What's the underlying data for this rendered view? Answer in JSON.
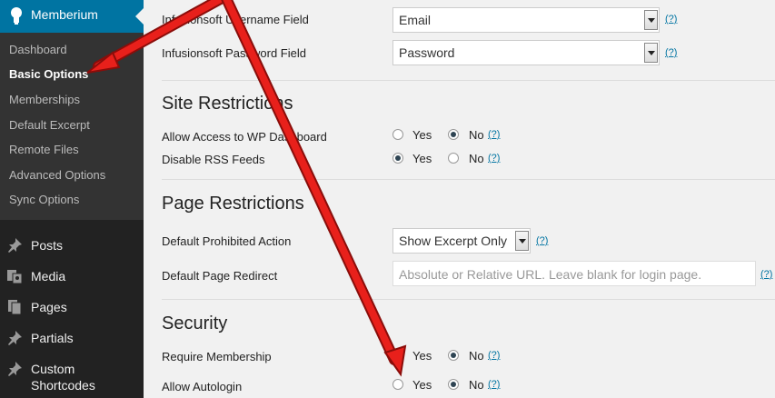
{
  "sidebar": {
    "active_title": "Memberium",
    "submenu": [
      "Dashboard",
      "Basic Options",
      "Memberships",
      "Default Excerpt",
      "Remote Files",
      "Advanced Options",
      "Sync Options"
    ],
    "menu": [
      {
        "label": "Posts",
        "icon": "pin-icon"
      },
      {
        "label": "Media",
        "icon": "media-icon"
      },
      {
        "label": "Pages",
        "icon": "pages-icon"
      },
      {
        "label": "Partials",
        "icon": "pin-icon"
      },
      {
        "label": "Custom Shortcodes",
        "icon": "pin-icon"
      }
    ]
  },
  "fields": {
    "username": {
      "label": "Infusionsoft Username Field",
      "value": "Email"
    },
    "password": {
      "label": "Infusionsoft Password Field",
      "value": "Password"
    }
  },
  "help_text": "(?)",
  "yes": "Yes",
  "no": "No",
  "site_restrictions": {
    "title": "Site Restrictions",
    "rows": [
      {
        "label": "Allow Access to WP Dashboard",
        "selected": "No"
      },
      {
        "label": "Disable RSS Feeds",
        "selected": "Yes"
      }
    ]
  },
  "page_restrictions": {
    "title": "Page Restrictions",
    "prohibited_label": "Default Prohibited Action",
    "prohibited_value": "Show Excerpt Only",
    "redirect_label": "Default Page Redirect",
    "redirect_placeholder": "Absolute or Relative URL.  Leave blank for login page."
  },
  "security": {
    "title": "Security",
    "rows": [
      {
        "label": "Require Membership",
        "selected": "No"
      },
      {
        "label": "Allow Autologin",
        "selected": "No"
      }
    ]
  },
  "colors": {
    "accent": "#0074a2",
    "sidebar": "#222222",
    "arrow": "#e8201b"
  }
}
